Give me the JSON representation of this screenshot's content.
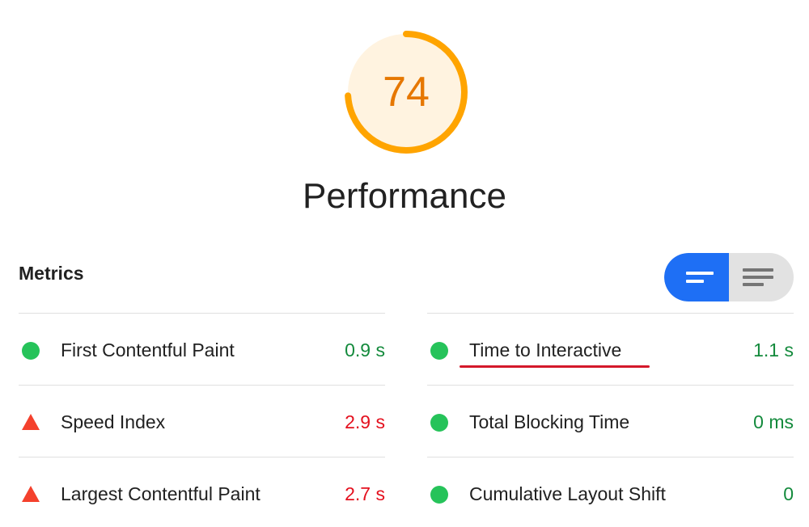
{
  "gauge": {
    "score": "74",
    "score_fraction": 0.74,
    "arc_color": "#ffa400",
    "fill_color": "#fff3e0",
    "text_color": "#e67700"
  },
  "category": {
    "title": "Performance"
  },
  "metrics": {
    "title": "Metrics",
    "toggle": {
      "active_icon": "lines-short-icon",
      "inactive_icon": "lines-list-icon"
    },
    "left": [
      {
        "label": "First Contentful Paint",
        "value": "0.9 s",
        "status": "pass"
      },
      {
        "label": "Speed Index",
        "value": "2.9 s",
        "status": "fail"
      },
      {
        "label": "Largest Contentful Paint",
        "value": "2.7 s",
        "status": "fail"
      }
    ],
    "right": [
      {
        "label": "Time to Interactive",
        "value": "1.1 s",
        "status": "pass"
      },
      {
        "label": "Total Blocking Time",
        "value": "0 ms",
        "status": "pass"
      },
      {
        "label": "Cumulative Layout Shift",
        "value": "0",
        "status": "pass"
      }
    ]
  },
  "colors": {
    "pass": "#26c35a",
    "fail": "#f4412d",
    "toggle_active": "#1e6ff5",
    "highlight_underline": "#d4182a"
  }
}
